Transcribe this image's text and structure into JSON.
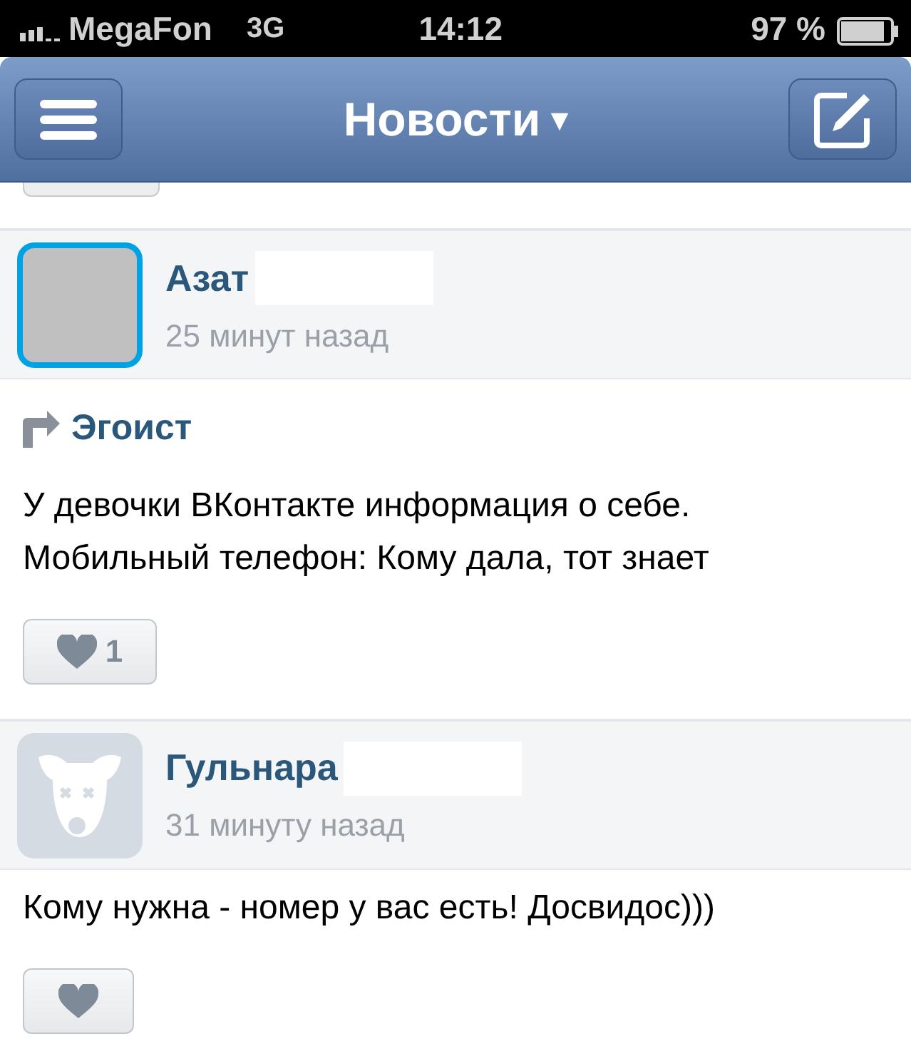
{
  "status_bar": {
    "carrier": "MegaFon",
    "network": "3G",
    "time": "14:12",
    "battery": "97 %"
  },
  "nav_bar": {
    "title": "Новости",
    "caret": "▾"
  },
  "posts": [
    {
      "author": "Азат",
      "author_redacted": true,
      "time": "25 минут назад",
      "avatar": {
        "kind": "blank",
        "highlighted": true
      },
      "repost_from": "Эгоист",
      "text": "У девочки ВКонтакте информация о себе. Мобильный телефон: Кому дала, тот знает",
      "likes": "1"
    },
    {
      "author": "Гульнара",
      "author_redacted": true,
      "time": "31 минуту назад",
      "avatar": {
        "kind": "deactivated",
        "highlighted": false
      },
      "text": "Кому нужна - номер у вас есть! Досвидос)))"
    }
  ]
}
